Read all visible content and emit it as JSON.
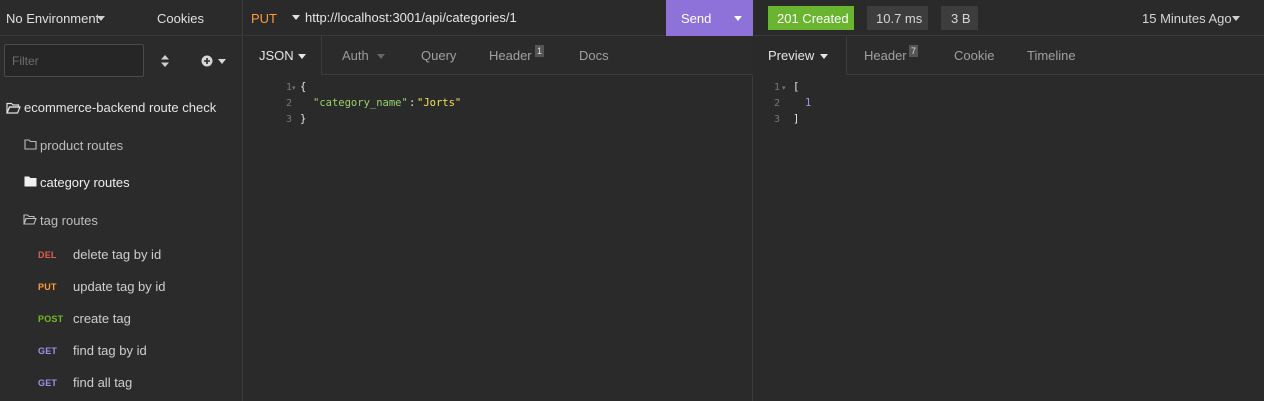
{
  "sidebar": {
    "environment_label": "No Environment",
    "cookies_label": "Cookies",
    "filter_placeholder": "Filter",
    "workspace_name": "ecommerce-backend route check",
    "folders": [
      {
        "label": "product routes",
        "state": "closed"
      },
      {
        "label": "category routes",
        "state": "filled"
      },
      {
        "label": "tag routes",
        "state": "open"
      }
    ],
    "requests": [
      {
        "method": "DEL",
        "label": "delete tag by id",
        "color": "#e55b4d"
      },
      {
        "method": "PUT",
        "label": "update tag by id",
        "color": "#ff9a3d"
      },
      {
        "method": "POST",
        "label": "create tag",
        "color": "#75ba24"
      },
      {
        "method": "GET",
        "label": "find tag by id",
        "color": "#a48fe6"
      },
      {
        "method": "GET",
        "label": "find all tag",
        "color": "#a48fe6"
      }
    ]
  },
  "request": {
    "method": "PUT",
    "url": "http://localhost:3001/api/categories/1",
    "send_label": "Send",
    "tabs": [
      {
        "label": "JSON",
        "active": true
      },
      {
        "label": "Auth",
        "active": false
      },
      {
        "label": "Query",
        "active": false
      },
      {
        "label": "Header",
        "active": false,
        "count": "1"
      },
      {
        "label": "Docs",
        "active": false
      }
    ],
    "line_numbers": [
      "1",
      "2",
      "3"
    ],
    "body": {
      "open": "{",
      "key": "\"category_name\"",
      "colon": ": ",
      "value": "\"Jorts\"",
      "close": "}"
    }
  },
  "response": {
    "status": "201 Created",
    "time": "10.7 ms",
    "size": "3 B",
    "history": "15 Minutes Ago",
    "tabs": [
      {
        "label": "Preview",
        "active": true
      },
      {
        "label": "Header",
        "active": false,
        "count": "7"
      },
      {
        "label": "Cookie",
        "active": false
      },
      {
        "label": "Timeline",
        "active": false
      }
    ],
    "line_numbers": [
      "1",
      "2",
      "3"
    ],
    "body": {
      "open": "[",
      "value": "1",
      "close": "]"
    }
  },
  "colors": {
    "accent_send": "#8e72d9",
    "status_success": "#6ab52f",
    "method_put": "#ff9a3d",
    "json_key": "#9bd16b",
    "json_string": "#f2e15a",
    "json_number": "#a48fe6"
  }
}
